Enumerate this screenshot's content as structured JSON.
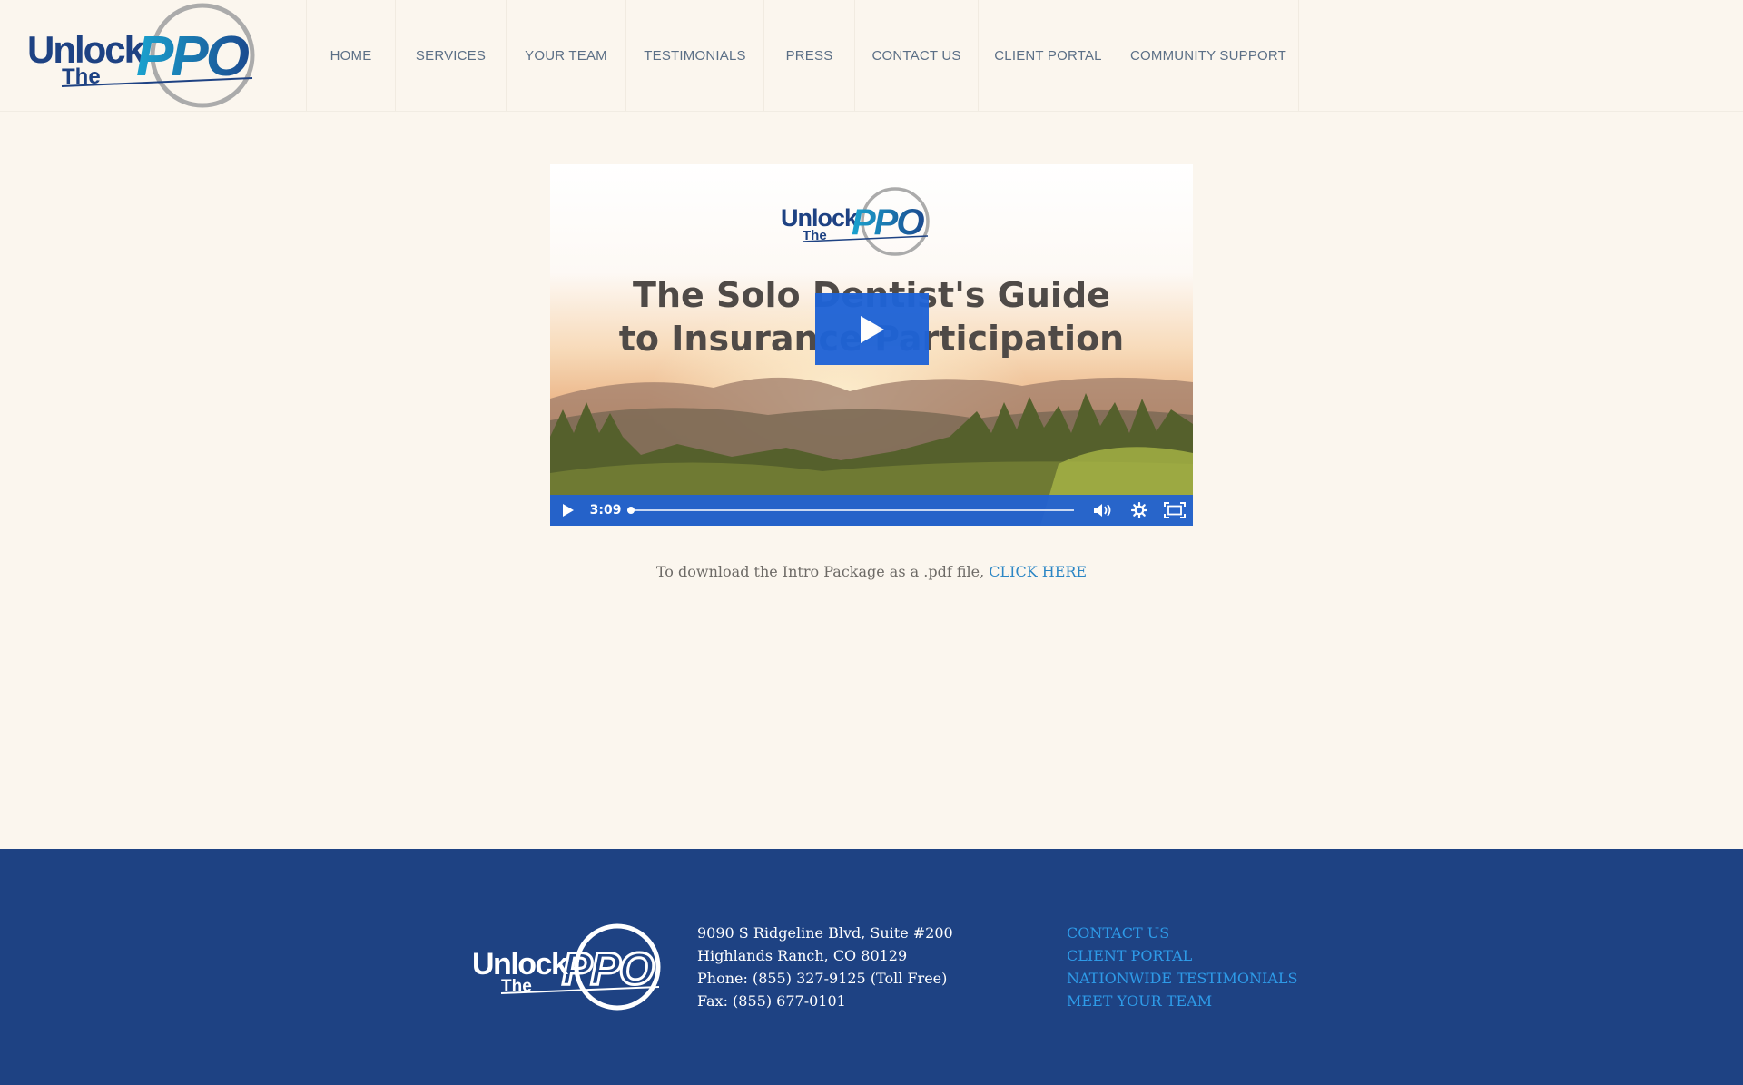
{
  "header": {
    "logo": {
      "word1": "Unlock",
      "word2": "The",
      "word3": "PPO"
    },
    "nav": [
      {
        "label": "HOME",
        "name": "home"
      },
      {
        "label": "SERVICES",
        "name": "services"
      },
      {
        "label": "YOUR TEAM",
        "name": "your-team"
      },
      {
        "label": "TESTIMONIALS",
        "name": "testimonials"
      },
      {
        "label": "PRESS",
        "name": "press"
      },
      {
        "label": "CONTACT US",
        "name": "contact-us"
      },
      {
        "label": "CLIENT PORTAL",
        "name": "client-portal"
      },
      {
        "label": "COMMUNITY SUPPORT",
        "name": "community-support"
      }
    ]
  },
  "video": {
    "logo": {
      "word1": "Unlock",
      "word2": "The",
      "word3": "PPO"
    },
    "title_line1": "The Solo Dentist's Guide",
    "title_line2": "to Insurance Participation",
    "duration": "3:09",
    "progress": 0,
    "icons": [
      "play-icon",
      "volume-icon",
      "settings-icon",
      "fullscreen-icon"
    ],
    "accent_color": "#1f63d6"
  },
  "download": {
    "text": "To download the Intro Package as a .pdf file,",
    "link": "CLICK HERE"
  },
  "footer": {
    "logo": {
      "word1": "Unlock",
      "word2": "The",
      "word3": "PPO"
    },
    "address": {
      "line1": "9090 S Ridgeline Blvd, Suite #200",
      "line2": "Highlands Ranch, CO  80129",
      "phone": "Phone: (855) 327-9125 (Toll Free)",
      "fax": "Fax: (855) 677-0101"
    },
    "links": [
      {
        "label": "CONTACT US",
        "name": "contact-us"
      },
      {
        "label": "CLIENT PORTAL",
        "name": "client-portal"
      },
      {
        "label": "NATIONWIDE TESTIMONIALS",
        "name": "nationwide-testimonials"
      },
      {
        "label": "MEET YOUR TEAM",
        "name": "meet-your-team"
      }
    ],
    "background_color": "#1e4283",
    "link_color": "#2e9be8"
  }
}
